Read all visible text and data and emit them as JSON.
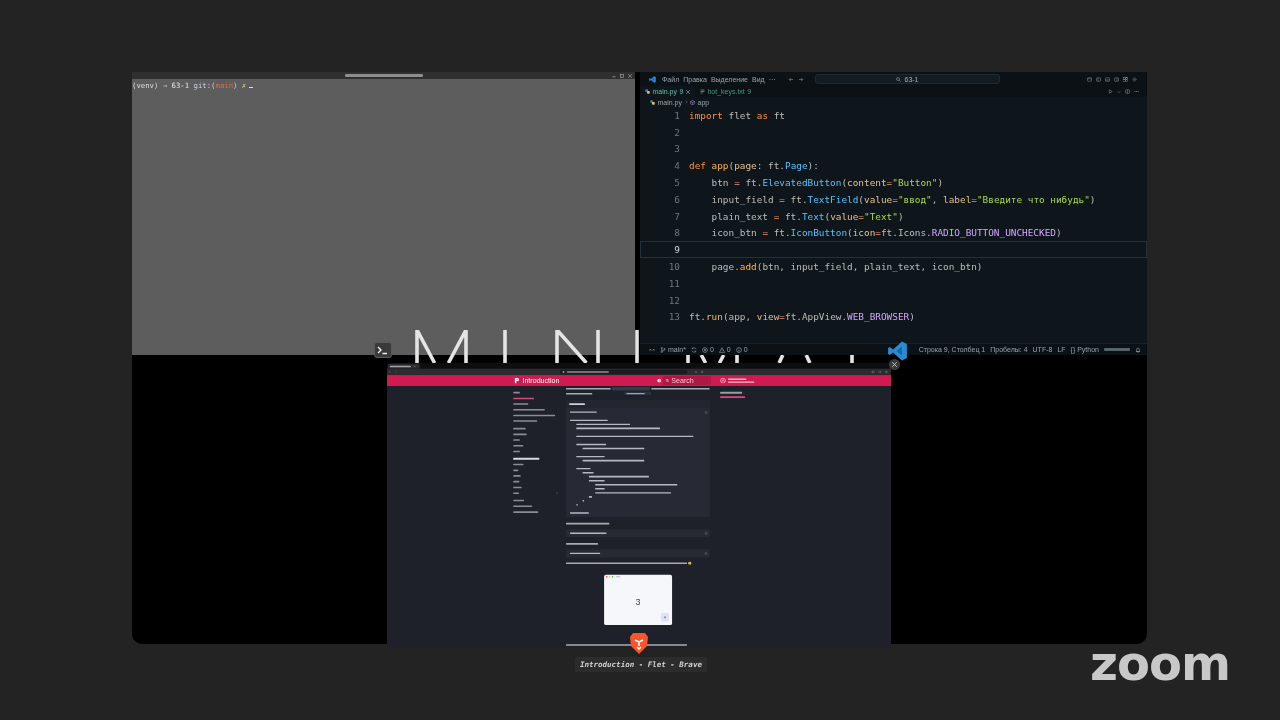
{
  "meeting": {
    "logo": "zoom"
  },
  "terminal": {
    "prompt": [
      {
        "text": "(venv)",
        "kind": "venv"
      },
      {
        "text": " →",
        "kind": "arrow"
      },
      {
        "text": " 63-1",
        "kind": "dir"
      },
      {
        "text": " git:(",
        "kind": "git"
      },
      {
        "text": "main",
        "kind": "branch"
      },
      {
        "text": ")",
        "kind": "git"
      },
      {
        "text": " ✗",
        "kind": "dirty"
      }
    ]
  },
  "editor": {
    "menu": [
      "Файл",
      "Правка",
      "Выделение",
      "Вид",
      "···"
    ],
    "command_center": "63-1",
    "tabs": [
      {
        "label": "main.py",
        "badge": "9",
        "kind": "python",
        "selected": true
      },
      {
        "label": "hot_keys.txt",
        "badge": "9",
        "kind": "text",
        "selected": false
      }
    ],
    "breadcrumb": [
      {
        "text": "main.py",
        "kind": "file"
      },
      {
        "text": "app",
        "kind": "function"
      }
    ],
    "lines": [
      {
        "number": "1",
        "active": false,
        "tokens": [
          {
            "text": "import",
            "kind": "keyword"
          },
          {
            "text": " flet ",
            "kind": "plain"
          },
          {
            "text": "as",
            "kind": "keyword"
          },
          {
            "text": " ft",
            "kind": "plain"
          }
        ]
      },
      {
        "number": "2",
        "active": false
      },
      {
        "number": "3",
        "active": false
      },
      {
        "number": "4",
        "active": false,
        "tokens": [
          {
            "text": "def",
            "kind": "keyword"
          },
          {
            "text": " app",
            "kind": "function"
          },
          {
            "text": "(",
            "kind": "plain"
          },
          {
            "text": "page",
            "kind": "param"
          },
          {
            "text": ": ft.",
            "kind": "plain"
          },
          {
            "text": "Page",
            "kind": "class"
          },
          {
            "text": "):",
            "kind": "plain"
          }
        ],
        "children": [
          {
            "number": "5",
            "active": false,
            "tokens": [
              {
                "text": "btn ",
                "kind": "plain"
              },
              {
                "text": "=",
                "kind": "operator"
              },
              {
                "text": " ft.",
                "kind": "plain"
              },
              {
                "text": "ElevatedButton",
                "kind": "class"
              },
              {
                "text": "(",
                "kind": "plain"
              },
              {
                "text": "content",
                "kind": "param"
              },
              {
                "text": "=",
                "kind": "operator"
              },
              {
                "text": "\"Button\"",
                "kind": "string"
              },
              {
                "text": ")",
                "kind": "plain"
              }
            ]
          },
          {
            "number": "6",
            "active": false,
            "tokens": [
              {
                "text": "input_field ",
                "kind": "plain"
              },
              {
                "text": "=",
                "kind": "operator"
              },
              {
                "text": " ft.",
                "kind": "plain"
              },
              {
                "text": "TextField",
                "kind": "class"
              },
              {
                "text": "(",
                "kind": "plain"
              },
              {
                "text": "value",
                "kind": "param"
              },
              {
                "text": "=",
                "kind": "operator"
              },
              {
                "text": "\"ввод\"",
                "kind": "string"
              },
              {
                "text": ", ",
                "kind": "plain"
              },
              {
                "text": "label",
                "kind": "param"
              },
              {
                "text": "=",
                "kind": "operator"
              },
              {
                "text": "\"Введите что нибудь\"",
                "kind": "string"
              },
              {
                "text": ")",
                "kind": "plain"
              }
            ]
          },
          {
            "number": "7",
            "active": false,
            "tokens": [
              {
                "text": "plain_text ",
                "kind": "plain"
              },
              {
                "text": "=",
                "kind": "operator"
              },
              {
                "text": " ft.",
                "kind": "plain"
              },
              {
                "text": "Text",
                "kind": "class"
              },
              {
                "text": "(",
                "kind": "plain"
              },
              {
                "text": "value",
                "kind": "param"
              },
              {
                "text": "=",
                "kind": "operator"
              },
              {
                "text": "\"Text\"",
                "kind": "string"
              },
              {
                "text": ")",
                "kind": "plain"
              }
            ]
          },
          {
            "number": "8",
            "active": false,
            "tokens": [
              {
                "text": "icon_btn ",
                "kind": "plain"
              },
              {
                "text": "=",
                "kind": "operator"
              },
              {
                "text": " ft.",
                "kind": "plain"
              },
              {
                "text": "IconButton",
                "kind": "class"
              },
              {
                "text": "(",
                "kind": "plain"
              },
              {
                "text": "icon",
                "kind": "param"
              },
              {
                "text": "=",
                "kind": "operator"
              },
              {
                "text": "ft.Icons.",
                "kind": "plain"
              },
              {
                "text": "RADIO_BUTTON_UNCHECKED",
                "kind": "constant"
              },
              {
                "text": ")",
                "kind": "plain"
              }
            ]
          },
          {
            "number": "9",
            "active": true
          },
          {
            "number": "10",
            "active": false,
            "tokens": [
              {
                "text": "page.",
                "kind": "plain"
              },
              {
                "text": "add",
                "kind": "function"
              },
              {
                "text": "(btn, input_field, plain_text, icon_btn)",
                "kind": "plain"
              }
            ]
          }
        ]
      },
      {
        "number": "11",
        "active": false
      },
      {
        "number": "12",
        "active": false
      },
      {
        "number": "13",
        "active": false,
        "tokens": [
          {
            "text": "ft.",
            "kind": "plain"
          },
          {
            "text": "run",
            "kind": "function"
          },
          {
            "text": "(app, ",
            "kind": "plain"
          },
          {
            "text": "view",
            "kind": "param"
          },
          {
            "text": "=",
            "kind": "operator"
          },
          {
            "text": "ft.AppView.",
            "kind": "plain"
          },
          {
            "text": "WEB_BROWSER",
            "kind": "constant"
          },
          {
            "text": ")",
            "kind": "plain"
          }
        ]
      }
    ],
    "status_left": [
      {
        "kind": "branch",
        "text": "main*"
      },
      {
        "kind": "errors",
        "text": "0"
      },
      {
        "kind": "warnings",
        "text": "0"
      },
      {
        "kind": "info",
        "text": "0"
      }
    ],
    "status_right": [
      "Строка 9, Столбец 1",
      "Пробелы: 4",
      "UTF-8",
      "LF",
      "{} Python"
    ]
  },
  "browser": {
    "tabs": [
      {
        "selected": true
      }
    ],
    "header": {
      "title": "Introduction",
      "search": {
        "placeholder": "Search"
      }
    },
    "nav": [
      {
        "items": [
          {
            "kind": "link",
            "selected": false
          },
          {
            "kind": "link",
            "selected": true
          },
          {
            "kind": "link",
            "selected": false
          },
          {
            "kind": "link",
            "selected": false
          },
          {
            "kind": "link",
            "selected": false
          },
          {
            "kind": "link",
            "selected": false
          }
        ]
      },
      {
        "items": [
          {
            "kind": "link",
            "selected": false
          },
          {
            "kind": "link",
            "selected": false
          },
          {
            "kind": "link",
            "selected": false
          },
          {
            "kind": "link",
            "selected": false
          },
          {
            "kind": "link",
            "selected": false
          }
        ]
      },
      {
        "items": [
          {
            "kind": "heading",
            "selected": false
          },
          {
            "kind": "link",
            "selected": false
          },
          {
            "kind": "link",
            "selected": false
          },
          {
            "kind": "link",
            "selected": false
          },
          {
            "kind": "link",
            "selected": false
          },
          {
            "kind": "link",
            "selected": false
          },
          {
            "kind": "group",
            "selected": false
          }
        ]
      },
      {
        "items": [
          {
            "kind": "link",
            "selected": false
          },
          {
            "kind": "link",
            "selected": false
          },
          {
            "kind": "link",
            "selected": false
          }
        ]
      }
    ],
    "content": [
      {
        "kind": "intro_hidden",
        "tooltip": true
      },
      {
        "kind": "code"
      },
      {
        "kind": "text"
      },
      {
        "kind": "command"
      },
      {
        "kind": "text"
      },
      {
        "kind": "command"
      },
      {
        "kind": "text_emoji"
      },
      {
        "kind": "app_preview",
        "value": "3"
      },
      {
        "kind": "outro_hidden"
      }
    ],
    "toc": [
      {
        "kind": "title",
        "selected": false
      },
      {
        "kind": "link",
        "selected": true
      }
    ]
  },
  "window_switcher": {
    "title": "Introduction - Flet - Brave"
  }
}
